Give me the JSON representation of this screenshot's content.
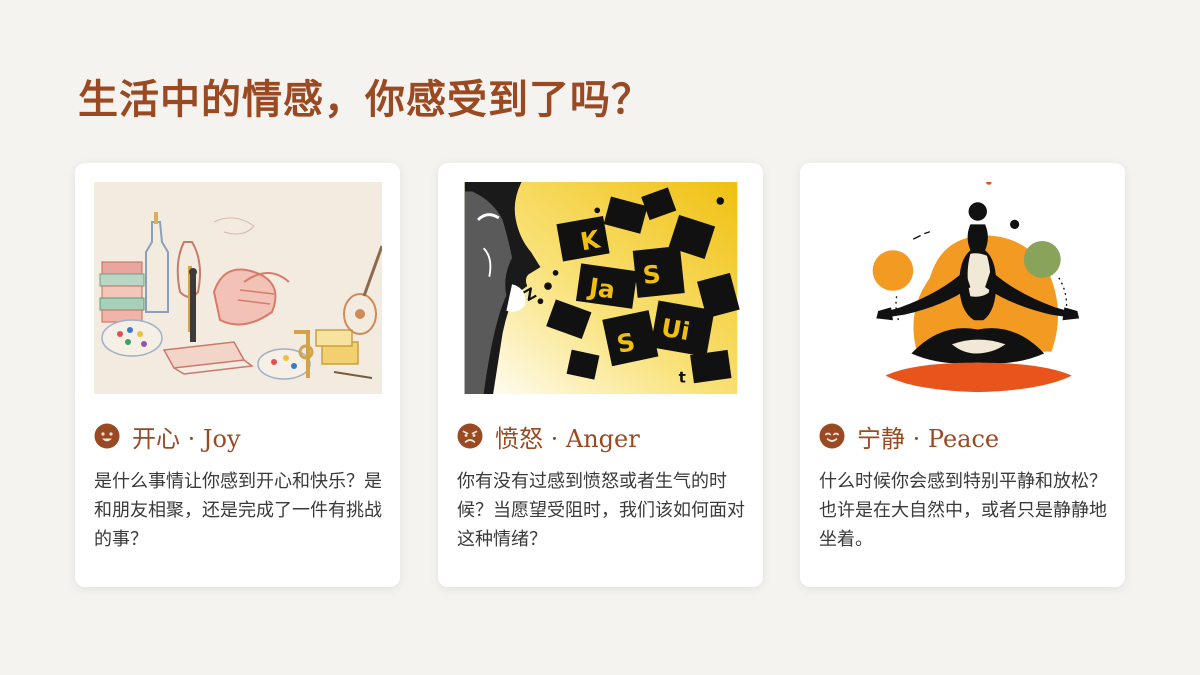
{
  "page": {
    "title": "生活中的情感，你感受到了吗？"
  },
  "accent_color": "#9a4a22",
  "cards": [
    {
      "heading": "开心 · Joy",
      "face_icon": "smiling-face-icon",
      "illustration": "joy-illustration",
      "description": "是什么事情让你感到开心和快乐？是和朋友相聚，还是完成了一件有挑战的事？"
    },
    {
      "heading": "愤怒 · Anger",
      "face_icon": "angry-face-icon",
      "illustration": "anger-illustration",
      "description": "你有没有过感到愤怒或者生气的时候？当愿望受阻时，我们该如何面对这种情绪？"
    },
    {
      "heading": "宁静 · Peace",
      "face_icon": "calm-face-icon",
      "illustration": "peace-illustration",
      "description": "什么时候你会感到特别平静和放松？也许是在大自然中，或者只是静静地坐着。"
    }
  ]
}
